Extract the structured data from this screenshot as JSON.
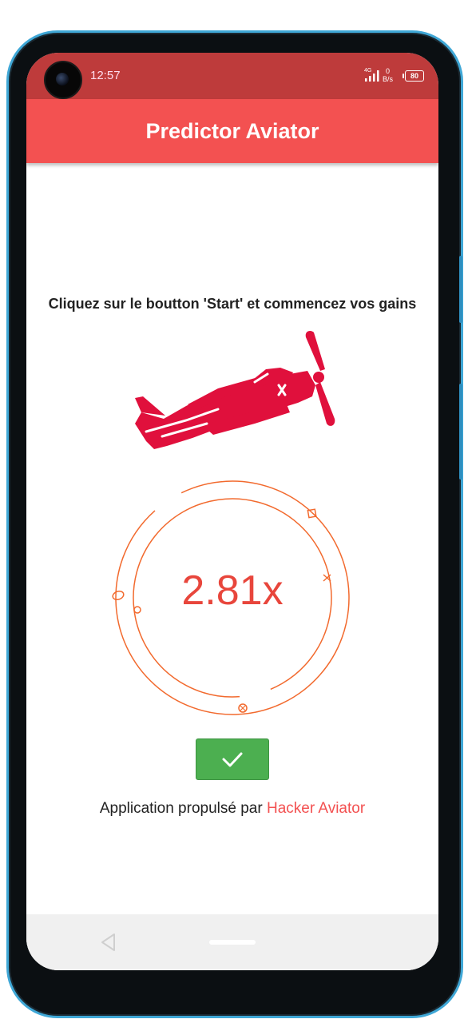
{
  "status_bar": {
    "time": "12:57",
    "network_type": "4G",
    "net_speed_value": "0",
    "net_speed_unit": "B/s",
    "battery_level": "80"
  },
  "app_bar": {
    "title": "Predictor Aviator"
  },
  "main": {
    "instruction": "Cliquez sur le boutton 'Start' et commencez vos gains",
    "plane_icon": "plane-icon",
    "multiplier": "2.81x",
    "start_button_icon": "checkmark-icon"
  },
  "footer": {
    "prefix": "Application propulsé par",
    "brand": "Hacker Aviator"
  },
  "colors": {
    "status_bar": "#be3b3b",
    "app_bar": "#f35151",
    "accent_red": "#e8463c",
    "plane_red": "#e0103c",
    "button_green": "#4caf50",
    "gauge_orange": "#f26a2e",
    "nav_bar": "#f0f0f0"
  }
}
